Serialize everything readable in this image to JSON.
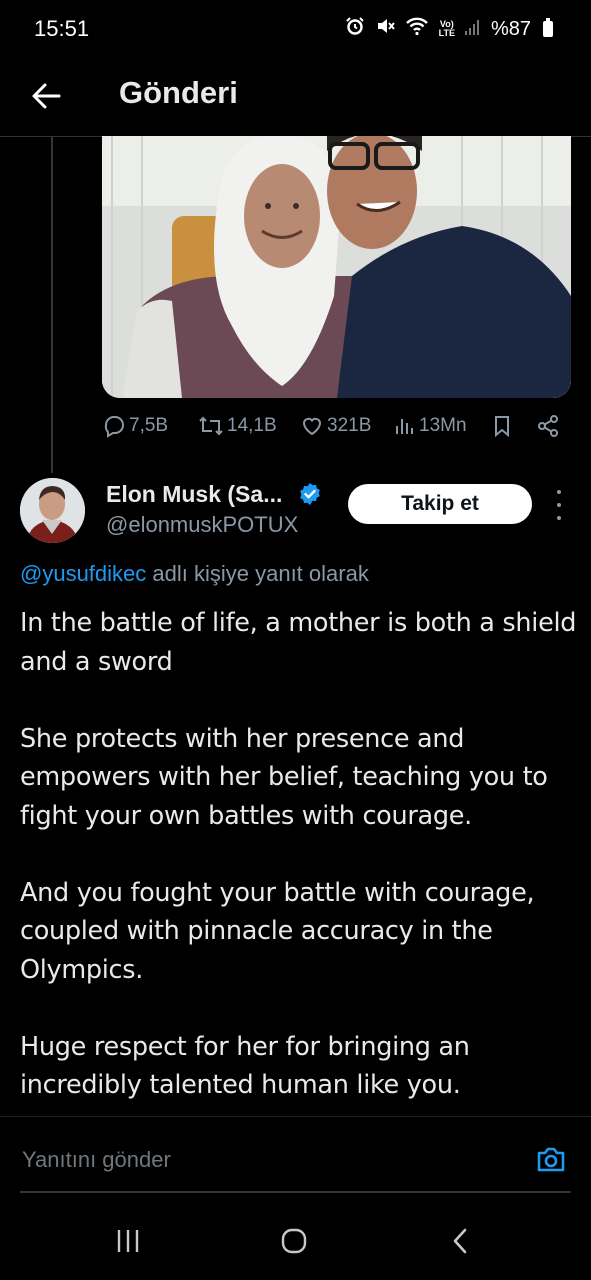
{
  "status": {
    "time": "15:51",
    "lte": "Vo)\nLTE",
    "battery": "%87"
  },
  "header": {
    "title": "Gönderi"
  },
  "parent_tweet": {
    "stats": {
      "replies": "7,5B",
      "retweets": "14,1B",
      "likes": "321B",
      "views": "13Mn"
    }
  },
  "tweet": {
    "author_name": "Elon Musk (Sa...",
    "handle": "@elonmuskPOTUX",
    "follow_label": "Takip et",
    "reply_mention": "@yusufdikec",
    "reply_suffix": " adlı kişiye yanıt olarak",
    "paragraphs": [
      "In the battle of life, a mother is both a shield and a sword",
      "She protects with her presence and empowers with her belief, teaching you to fight your own battles with courage.",
      "And you fought your battle with courage, coupled with pinnacle accuracy in the Olympics.",
      "Huge respect for her for bringing an incredibly talented human like you."
    ]
  },
  "reply_bar": {
    "placeholder": "Yanıtını gönder"
  },
  "colors": {
    "accent": "#1d9bf0",
    "background": "#000000",
    "muted": "#8b98a5"
  }
}
